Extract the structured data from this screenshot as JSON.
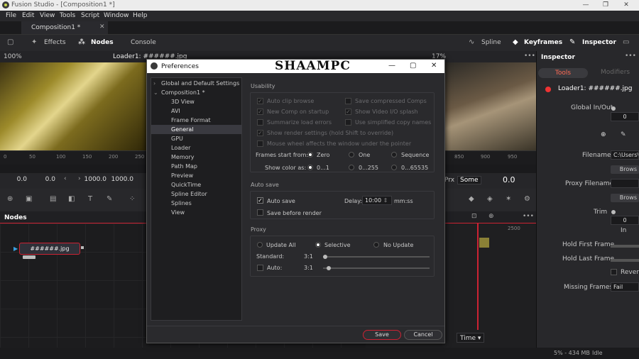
{
  "app": {
    "window_title": "Fusion Studio - [Composition1 *]"
  },
  "menu": [
    "File",
    "Edit",
    "View",
    "Tools",
    "Script",
    "Window",
    "Help"
  ],
  "tabs": {
    "composition": "Composition1 *"
  },
  "toolbar": {
    "effects": "Effects",
    "nodes": "Nodes",
    "console": "Console",
    "spline": "Spline",
    "keyframes": "Keyframes",
    "inspector": "Inspector"
  },
  "viewer": {
    "zoom": "100%",
    "loader_label": "Loader1: ######.jpg",
    "zoom_right": "17%"
  },
  "ruler": [
    "0",
    "50",
    "100",
    "150",
    "200",
    "250",
    "850",
    "900",
    "950"
  ],
  "time": {
    "start": "0.0",
    "render_start": "0.0",
    "render_end": "1000.0",
    "end": "1000.0",
    "current": "0.0",
    "prx": "Prx",
    "some": "Some"
  },
  "nodes_panel": {
    "title": "Nodes",
    "node_label": "######.jpg"
  },
  "keyframes": {
    "mark": "2500",
    "time_mode": "Time"
  },
  "status": {
    "memory": "5% - 434 MB",
    "state": "Idle"
  },
  "inspector": {
    "title": "Inspector",
    "tab_tools": "Tools",
    "tab_modifiers": "Modifiers",
    "tool_name": "Loader1: ######.jpg",
    "global_inout": "Global In/Out",
    "global_value": "0",
    "filename_label": "Filename",
    "filename_value": "C:\\Users\\M",
    "browse": "Brows",
    "proxy_filename": "Proxy Filename",
    "browse2": "Brows",
    "trim": "Trim",
    "trim_value": "0",
    "trim_in": "In",
    "hold_first": "Hold First Frame",
    "hold_last": "Hold Last Frame",
    "reverse": "Revers",
    "missing_frames": "Missing Frames",
    "missing_value": "Fail"
  },
  "prefs": {
    "title": "Preferences",
    "watermark": "SHAAMPC",
    "tree": [
      {
        "label": "Global and Default Settings",
        "level": 0
      },
      {
        "label": "Composition1 *",
        "level": 0
      },
      {
        "label": "3D View",
        "level": 1
      },
      {
        "label": "AVI",
        "level": 1
      },
      {
        "label": "Frame Format",
        "level": 1
      },
      {
        "label": "General",
        "level": 1,
        "selected": true
      },
      {
        "label": "GPU",
        "level": 1
      },
      {
        "label": "Loader",
        "level": 1
      },
      {
        "label": "Memory",
        "level": 1
      },
      {
        "label": "Path Map",
        "level": 1
      },
      {
        "label": "Preview",
        "level": 1
      },
      {
        "label": "QuickTime",
        "level": 1
      },
      {
        "label": "Spline Editor",
        "level": 1
      },
      {
        "label": "Splines",
        "level": 1
      },
      {
        "label": "View",
        "level": 1
      }
    ],
    "usability": {
      "label": "Usability",
      "auto_clip_browse": "Auto clip browse",
      "save_compressed": "Save compressed Comps",
      "new_comp": "New Comp on startup",
      "show_video_io": "Show Video I/O splash",
      "summarize": "Summarize load errors",
      "simplified_copy": "Use simplified copy names",
      "show_render": "Show render settings (hold Shift to override)",
      "mouse_wheel": "Mouse wheel affects the window under the pointer",
      "frames_start_label": "Frames start from:",
      "fs_zero": "Zero",
      "fs_one": "One",
      "fs_sequence": "Sequence",
      "show_color_label": "Show color as:",
      "sc_01": "0...1",
      "sc_255": "0...255",
      "sc_65535": "0...65535"
    },
    "autosave": {
      "label": "Auto save",
      "auto_save": "Auto save",
      "delay_label": "Delay:",
      "delay_value": "10:00",
      "delay_unit": "mm:ss",
      "save_before": "Save before render"
    },
    "proxy": {
      "label": "Proxy",
      "update_all": "Update All",
      "selective": "Selective",
      "no_update": "No Update",
      "standard": "Standard:",
      "standard_value": "3:1",
      "auto": "Auto:",
      "auto_value": "3:1"
    },
    "buttons": {
      "save": "Save",
      "cancel": "Cancel"
    }
  }
}
